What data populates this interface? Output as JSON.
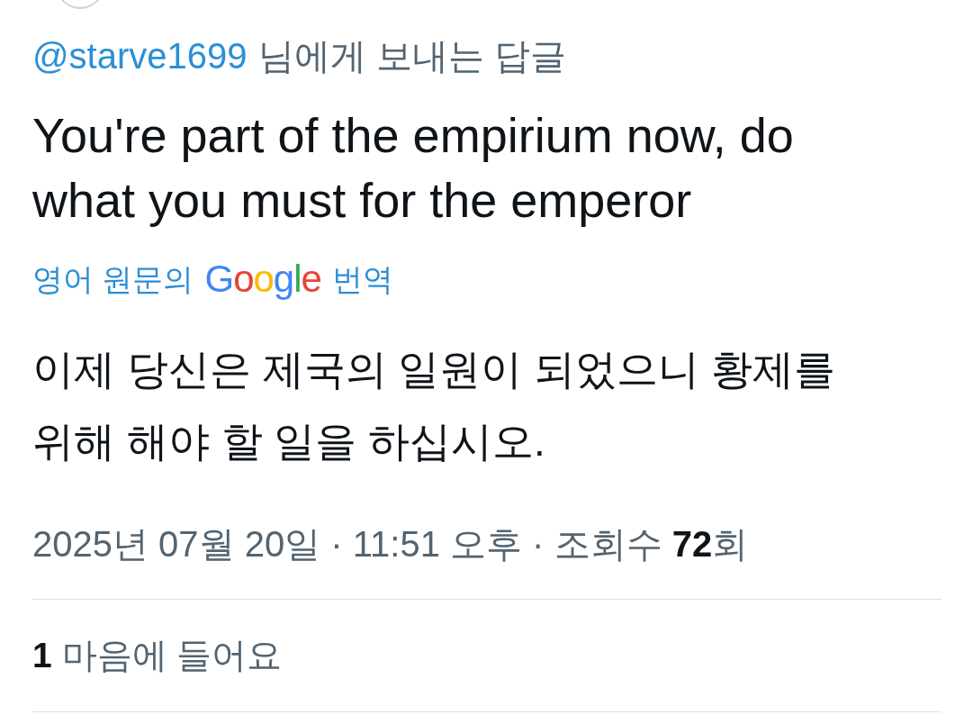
{
  "reply_context": {
    "handle": "@starve1699",
    "text": "님에게 보내는 답글"
  },
  "tweet": {
    "text": "You're part of the empirium now, do what you must for the emperor"
  },
  "translation": {
    "prefix": "영어 원문의",
    "logo": "Google",
    "suffix": "번역",
    "text": "이제 당신은 제국의 일원이 되었으니 황제를 위해 해야 할 일을 하십시오."
  },
  "meta": {
    "timestamp": "2025년 07월 20일 · 11:51 오후 · 조회수 **72**회"
  },
  "stats": [
    {
      "text": "**1** 마음에 들어요"
    }
  ]
}
